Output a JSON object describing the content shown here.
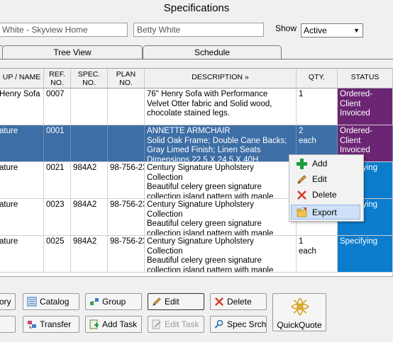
{
  "window": {
    "title": "Specifications"
  },
  "filters": {
    "project": "White - Skyview Home",
    "client": "Betty White",
    "show_label": "Show",
    "show_value": "Active"
  },
  "tabs": [
    {
      "label": ""
    },
    {
      "label": "Tree View"
    },
    {
      "label": "Schedule"
    }
  ],
  "table": {
    "columns": [
      {
        "label": "UP / NAME"
      },
      {
        "label": "REF.\nNO."
      },
      {
        "label": "SPEC.\nNO."
      },
      {
        "label": "PLAN\nNO."
      },
      {
        "label": "DESCRIPTION »"
      },
      {
        "label": "QTY."
      },
      {
        "label": "STATUS"
      }
    ],
    "rows": [
      {
        "name": "Henry Sofa",
        "ref": "0007",
        "spec": "",
        "plan": "",
        "desc": "76\" Henry Sofa with Performance\nVelvet Otter fabric and Solid wood,\nchocolate stained legs.",
        "qty": "1",
        "status": "Ordered-\nClient\nInvoiced"
      },
      {
        "name": "ature",
        "ref": "0001",
        "spec": "",
        "plan": "",
        "desc": "ANNETTE ARMCHAIR\nSolid Oak Frame; Double Cane Backs;\nGray Limed Finish; Linen Seats\nDimensions 22.5 X 24.5 X 40H",
        "qty": "2\neach",
        "status": "Ordered-\nClient\nInvoiced"
      },
      {
        "name": "ature",
        "ref": "0021",
        "spec": "984A2",
        "plan": "98-756-23",
        "desc": "Century Signature Upholstery\nCollection\nBeautiful celery green signature\ncollection island pattern with maple",
        "qty": "",
        "status": "Specifying"
      },
      {
        "name": "ature",
        "ref": "0023",
        "spec": "984A2",
        "plan": "98-756-23",
        "desc": "Century Signature Upholstery\nCollection\nBeautiful celery green signature\ncollection island pattern with maple",
        "qty": "",
        "status": "Specifying"
      },
      {
        "name": "ature",
        "ref": "0025",
        "spec": "984A2",
        "plan": "98-756-23",
        "desc": "Century Signature Upholstery\nCollection\nBeautiful celery green signature\ncollection island pattern with maple",
        "qty": "1\neach",
        "status": "Specifying"
      }
    ]
  },
  "context_menu": {
    "items": [
      {
        "label": "Add",
        "icon": "plus-icon"
      },
      {
        "label": "Edit",
        "icon": "pencil-icon"
      },
      {
        "label": "Delete",
        "icon": "x-icon"
      },
      {
        "label": "Export",
        "icon": "export-folder-icon"
      }
    ]
  },
  "toolbar": {
    "history": "ory",
    "catalog": "Catalog",
    "group": "Group",
    "edit": "Edit",
    "delete": "Delete",
    "transfer": "Transfer",
    "add_task": "Add Task",
    "edit_task": "Edit Task",
    "spec_srch": "Spec Srch",
    "quickquote": "QuickQuote"
  },
  "colors": {
    "selection": "#3d6ea5",
    "status_ordered": "#6b2573",
    "status_specifying": "#0c7ccd"
  }
}
